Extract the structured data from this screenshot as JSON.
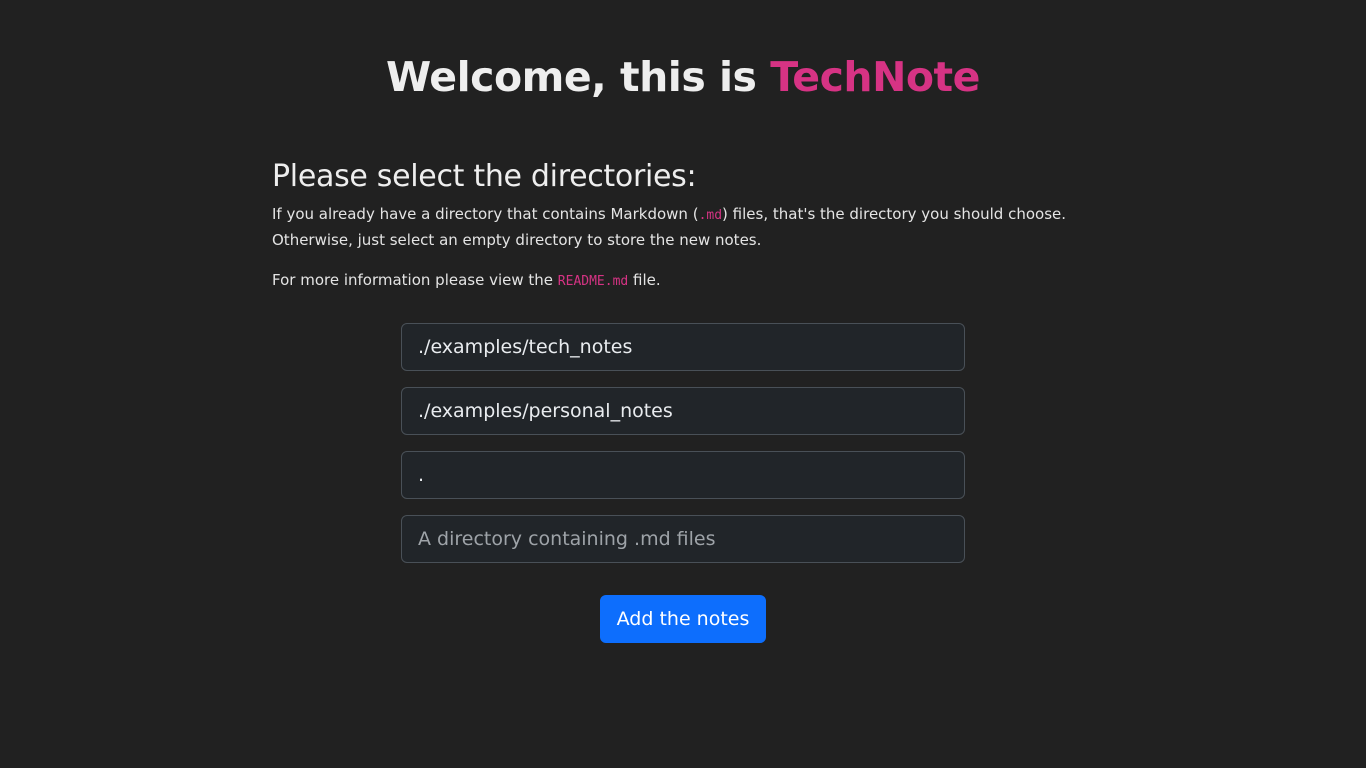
{
  "header": {
    "welcome_prefix": "Welcome, this is ",
    "brand": "TechNote"
  },
  "intro": {
    "title": "Please select the directories:",
    "p1_before": "If you already have a directory that contains Markdown (",
    "p1_code": ".md",
    "p1_after": ") files, that's the directory you should choose. Otherwise, just select an empty directory to store the new notes.",
    "p2_before": "For more information please view the ",
    "p2_code": "README.md",
    "p2_after": " file."
  },
  "form": {
    "inputs": [
      {
        "value": "./examples/tech_notes",
        "placeholder": "A directory containing .md files"
      },
      {
        "value": "./examples/personal_notes",
        "placeholder": "A directory containing .md files"
      },
      {
        "value": ".",
        "placeholder": "A directory containing .md files"
      },
      {
        "value": "",
        "placeholder": "A directory containing .md files"
      }
    ],
    "submit_label": "Add the notes"
  },
  "colors": {
    "background": "#212121",
    "brand": "#d63384",
    "button": "#0d6efd",
    "input_bg": "#212529",
    "input_border": "#495057"
  }
}
